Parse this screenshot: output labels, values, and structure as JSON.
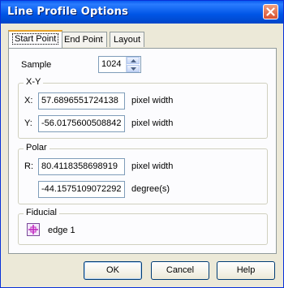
{
  "window": {
    "title": "Line Profile Options"
  },
  "tabs": [
    {
      "label": "Start Point",
      "active": true
    },
    {
      "label": "End Point",
      "active": false
    },
    {
      "label": "Layout",
      "active": false
    }
  ],
  "sample": {
    "label": "Sample",
    "value": "1024"
  },
  "xy": {
    "title": "X-Y",
    "x_label": "X:",
    "x_value": "57.6896551724138",
    "x_unit": "pixel width",
    "y_label": "Y:",
    "y_value": "-56.0175600508842",
    "y_unit": "pixel width"
  },
  "polar": {
    "title": "Polar",
    "r_label": "R:",
    "r_value": "80.4118358698919",
    "r_unit": "pixel width",
    "angle_value": "-44.1575109072292",
    "angle_unit": "degree(s)"
  },
  "fiducial": {
    "title": "Fiducial",
    "name": "edge 1",
    "icon": "crosshair-icon",
    "icon_color": "#c020c0"
  },
  "buttons": {
    "ok": "OK",
    "cancel": "Cancel",
    "help": "Help"
  },
  "colors": {
    "titlebar": "#0055e5",
    "dialog_bg": "#ece9d8",
    "tab_accent": "#e6a126"
  }
}
